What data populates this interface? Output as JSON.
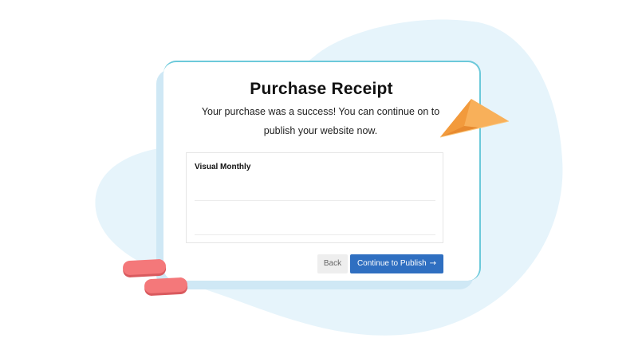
{
  "receipt": {
    "title": "Purchase Receipt",
    "message": "Your purchase was a success! You can continue on to publish your website now.",
    "plan_name": "Visual Monthly"
  },
  "actions": {
    "back_label": "Back",
    "continue_label": "Continue to Publish",
    "continue_icon": "arrow-right-icon",
    "continue_arrow": "→"
  },
  "colors": {
    "primary_button": "#2f6fc1",
    "background_blob": "#e6f4fb",
    "card_accent": "#6cc9da",
    "decor_pill": "#f4787a",
    "paper_plane": "#f6a94a"
  }
}
